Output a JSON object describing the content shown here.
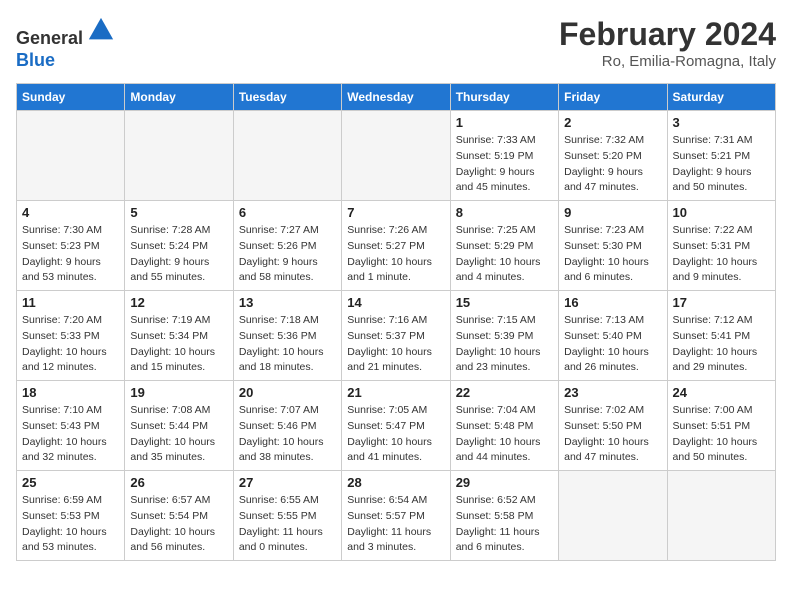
{
  "header": {
    "logo_line1": "General",
    "logo_line2": "Blue",
    "month_title": "February 2024",
    "location": "Ro, Emilia-Romagna, Italy"
  },
  "weekdays": [
    "Sunday",
    "Monday",
    "Tuesday",
    "Wednesday",
    "Thursday",
    "Friday",
    "Saturday"
  ],
  "weeks": [
    [
      {
        "day": "",
        "empty": true
      },
      {
        "day": "",
        "empty": true
      },
      {
        "day": "",
        "empty": true
      },
      {
        "day": "",
        "empty": true
      },
      {
        "day": "1",
        "sunrise": "7:33 AM",
        "sunset": "5:19 PM",
        "daylight": "9 hours and 45 minutes."
      },
      {
        "day": "2",
        "sunrise": "7:32 AM",
        "sunset": "5:20 PM",
        "daylight": "9 hours and 47 minutes."
      },
      {
        "day": "3",
        "sunrise": "7:31 AM",
        "sunset": "5:21 PM",
        "daylight": "9 hours and 50 minutes."
      }
    ],
    [
      {
        "day": "4",
        "sunrise": "7:30 AM",
        "sunset": "5:23 PM",
        "daylight": "9 hours and 53 minutes."
      },
      {
        "day": "5",
        "sunrise": "7:28 AM",
        "sunset": "5:24 PM",
        "daylight": "9 hours and 55 minutes."
      },
      {
        "day": "6",
        "sunrise": "7:27 AM",
        "sunset": "5:26 PM",
        "daylight": "9 hours and 58 minutes."
      },
      {
        "day": "7",
        "sunrise": "7:26 AM",
        "sunset": "5:27 PM",
        "daylight": "10 hours and 1 minute."
      },
      {
        "day": "8",
        "sunrise": "7:25 AM",
        "sunset": "5:29 PM",
        "daylight": "10 hours and 4 minutes."
      },
      {
        "day": "9",
        "sunrise": "7:23 AM",
        "sunset": "5:30 PM",
        "daylight": "10 hours and 6 minutes."
      },
      {
        "day": "10",
        "sunrise": "7:22 AM",
        "sunset": "5:31 PM",
        "daylight": "10 hours and 9 minutes."
      }
    ],
    [
      {
        "day": "11",
        "sunrise": "7:20 AM",
        "sunset": "5:33 PM",
        "daylight": "10 hours and 12 minutes."
      },
      {
        "day": "12",
        "sunrise": "7:19 AM",
        "sunset": "5:34 PM",
        "daylight": "10 hours and 15 minutes."
      },
      {
        "day": "13",
        "sunrise": "7:18 AM",
        "sunset": "5:36 PM",
        "daylight": "10 hours and 18 minutes."
      },
      {
        "day": "14",
        "sunrise": "7:16 AM",
        "sunset": "5:37 PM",
        "daylight": "10 hours and 21 minutes."
      },
      {
        "day": "15",
        "sunrise": "7:15 AM",
        "sunset": "5:39 PM",
        "daylight": "10 hours and 23 minutes."
      },
      {
        "day": "16",
        "sunrise": "7:13 AM",
        "sunset": "5:40 PM",
        "daylight": "10 hours and 26 minutes."
      },
      {
        "day": "17",
        "sunrise": "7:12 AM",
        "sunset": "5:41 PM",
        "daylight": "10 hours and 29 minutes."
      }
    ],
    [
      {
        "day": "18",
        "sunrise": "7:10 AM",
        "sunset": "5:43 PM",
        "daylight": "10 hours and 32 minutes."
      },
      {
        "day": "19",
        "sunrise": "7:08 AM",
        "sunset": "5:44 PM",
        "daylight": "10 hours and 35 minutes."
      },
      {
        "day": "20",
        "sunrise": "7:07 AM",
        "sunset": "5:46 PM",
        "daylight": "10 hours and 38 minutes."
      },
      {
        "day": "21",
        "sunrise": "7:05 AM",
        "sunset": "5:47 PM",
        "daylight": "10 hours and 41 minutes."
      },
      {
        "day": "22",
        "sunrise": "7:04 AM",
        "sunset": "5:48 PM",
        "daylight": "10 hours and 44 minutes."
      },
      {
        "day": "23",
        "sunrise": "7:02 AM",
        "sunset": "5:50 PM",
        "daylight": "10 hours and 47 minutes."
      },
      {
        "day": "24",
        "sunrise": "7:00 AM",
        "sunset": "5:51 PM",
        "daylight": "10 hours and 50 minutes."
      }
    ],
    [
      {
        "day": "25",
        "sunrise": "6:59 AM",
        "sunset": "5:53 PM",
        "daylight": "10 hours and 53 minutes."
      },
      {
        "day": "26",
        "sunrise": "6:57 AM",
        "sunset": "5:54 PM",
        "daylight": "10 hours and 56 minutes."
      },
      {
        "day": "27",
        "sunrise": "6:55 AM",
        "sunset": "5:55 PM",
        "daylight": "11 hours and 0 minutes."
      },
      {
        "day": "28",
        "sunrise": "6:54 AM",
        "sunset": "5:57 PM",
        "daylight": "11 hours and 3 minutes."
      },
      {
        "day": "29",
        "sunrise": "6:52 AM",
        "sunset": "5:58 PM",
        "daylight": "11 hours and 6 minutes."
      },
      {
        "day": "",
        "empty": true
      },
      {
        "day": "",
        "empty": true
      }
    ]
  ],
  "labels": {
    "sunrise": "Sunrise:",
    "sunset": "Sunset:",
    "daylight": "Daylight:"
  }
}
